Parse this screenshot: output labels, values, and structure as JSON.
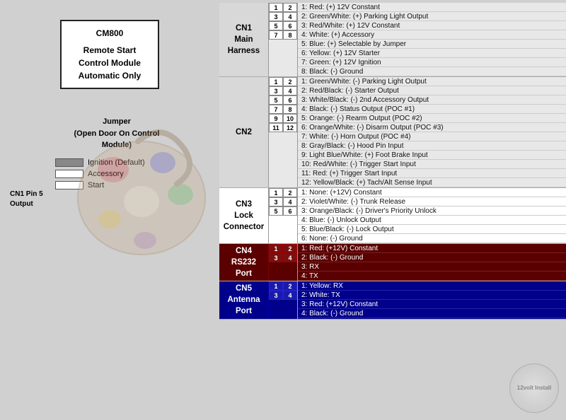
{
  "left": {
    "module_name": "CM800",
    "subtitle1": "Remote Start",
    "subtitle2": "Control Module",
    "subtitle3": "Automatic Only",
    "jumper_title": "Jumper",
    "jumper_subtitle": "(Open Door On Control",
    "jumper_subtitle2": "Module)",
    "cn1_pin5_label": "CN1 Pin 5\nOutput",
    "ignition_label": "Ignition (Default)",
    "accessory_label": "Accessory",
    "start_label": "Start"
  },
  "connectors": {
    "cn1": {
      "label": "CN1\nMain\nHarness",
      "pins": [
        {
          "pair": [
            1,
            2
          ],
          "descs": [
            "1: Red: (+) 12V Constant",
            "2: Green/White: (+) Parking Light Output"
          ]
        },
        {
          "pair": [
            3,
            4
          ],
          "descs": [
            "3: Red/White: (+) 12V Constant",
            "4: White: (+) Accessory"
          ]
        },
        {
          "pair": [
            5,
            6
          ],
          "descs": [
            "5: Blue: (+) Selectable by Jumper",
            "6: Yellow: (+) 12V Starter"
          ]
        },
        {
          "pair": [
            7,
            8
          ],
          "descs": [
            "7: Green: (+) 12V Ignition",
            "8: Black: (-) Ground"
          ]
        }
      ]
    },
    "cn2": {
      "label": "CN2",
      "pins": [
        {
          "pair": [
            1,
            2
          ],
          "descs": [
            "1: Green/White: (-) Parking Light Output",
            "2: Red/Black: (-) Starter Output"
          ]
        },
        {
          "pair": [
            3,
            4
          ],
          "descs": [
            "3: White/Black: (-) 2nd Accessory Output",
            "4: Black: (-) Status Output (POC #1)"
          ]
        },
        {
          "pair": [
            5,
            6
          ],
          "descs": [
            "5: Orange: (-) Rearm Output (POC #2)",
            "6: Orange/White: (-) Disarm Output (POC #3)"
          ]
        },
        {
          "pair": [
            7,
            8
          ],
          "descs": [
            "7: White: (-) Horn Output (POC #4)",
            "8: Gray/Black: (-) Hood Pin Input"
          ]
        },
        {
          "pair": [
            9,
            10
          ],
          "descs": [
            "9: Light Blue/White: (+) Foot Brake Input",
            "10: Red/White: (-) Trigger Start Input"
          ]
        },
        {
          "pair": [
            11,
            12
          ],
          "descs": [
            "11: Red: (+) Trigger Start Input",
            "12: Yellow/Black: (+) Tach/Alt Sense Input"
          ]
        }
      ]
    },
    "cn3": {
      "label": "CN3\nLock\nConnector",
      "pins": [
        {
          "pair": [
            1,
            2
          ],
          "descs": [
            "1: None: (+12V) Constant",
            "2: Violet/White: (-) Trunk Release"
          ]
        },
        {
          "pair": [
            3,
            4
          ],
          "descs": [
            "3: Orange/Black: (-) Driver's Priority Unlock",
            "4: Blue: (-) Unlock Output"
          ]
        },
        {
          "pair": [
            5,
            6
          ],
          "descs": [
            "5: Blue/Black: (-) Lock Output",
            "6: None: (-) Ground"
          ]
        }
      ]
    },
    "cn4": {
      "label": "CN4\nRS232\nPort",
      "color": "#4a0000",
      "pins": [
        {
          "pair": [
            1,
            2
          ],
          "descs": [
            "1: Red: (+12V) Constant",
            "2: Black: (-) Ground"
          ]
        },
        {
          "pair": [
            3,
            4
          ],
          "descs": [
            "3: RX",
            "4: TX"
          ]
        }
      ]
    },
    "cn5": {
      "label": "CN5\nAntenna\nPort",
      "color": "#00008b",
      "pins": [
        {
          "pair": [
            1,
            2
          ],
          "descs": [
            "1: Yellow: RX",
            "2: White: TX"
          ]
        },
        {
          "pair": [
            3,
            4
          ],
          "descs": [
            "3: Red: (+12V) Constant",
            "4: Black: (-) Ground"
          ]
        }
      ]
    }
  },
  "watermark": "12volt\nInstall"
}
